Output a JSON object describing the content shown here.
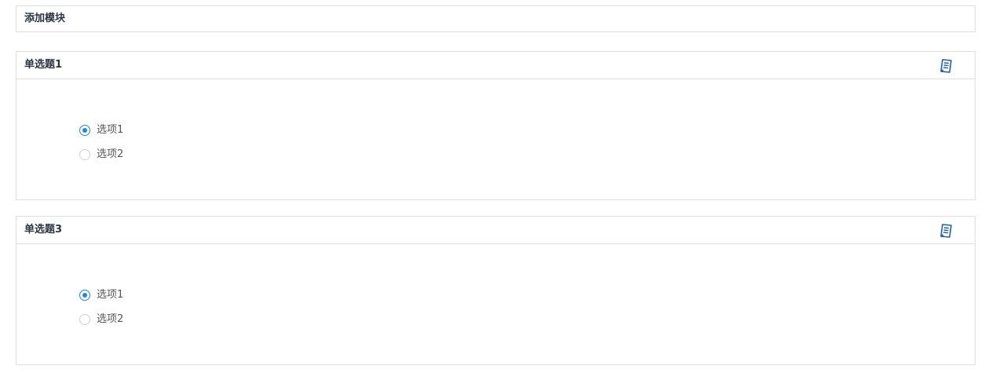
{
  "add_module": {
    "title": "添加模块"
  },
  "questions": [
    {
      "title": "单选题1",
      "icon": "edit-note-icon",
      "options": [
        {
          "label": "选项1",
          "checked": true
        },
        {
          "label": "选项2",
          "checked": false
        }
      ]
    },
    {
      "title": "单选题3",
      "icon": "edit-note-icon",
      "options": [
        {
          "label": "选项1",
          "checked": true
        },
        {
          "label": "选项2",
          "checked": false
        }
      ]
    }
  ],
  "colors": {
    "accent": "#1e88e5",
    "icon": "#1f5fa8",
    "border": "#dddddd"
  }
}
